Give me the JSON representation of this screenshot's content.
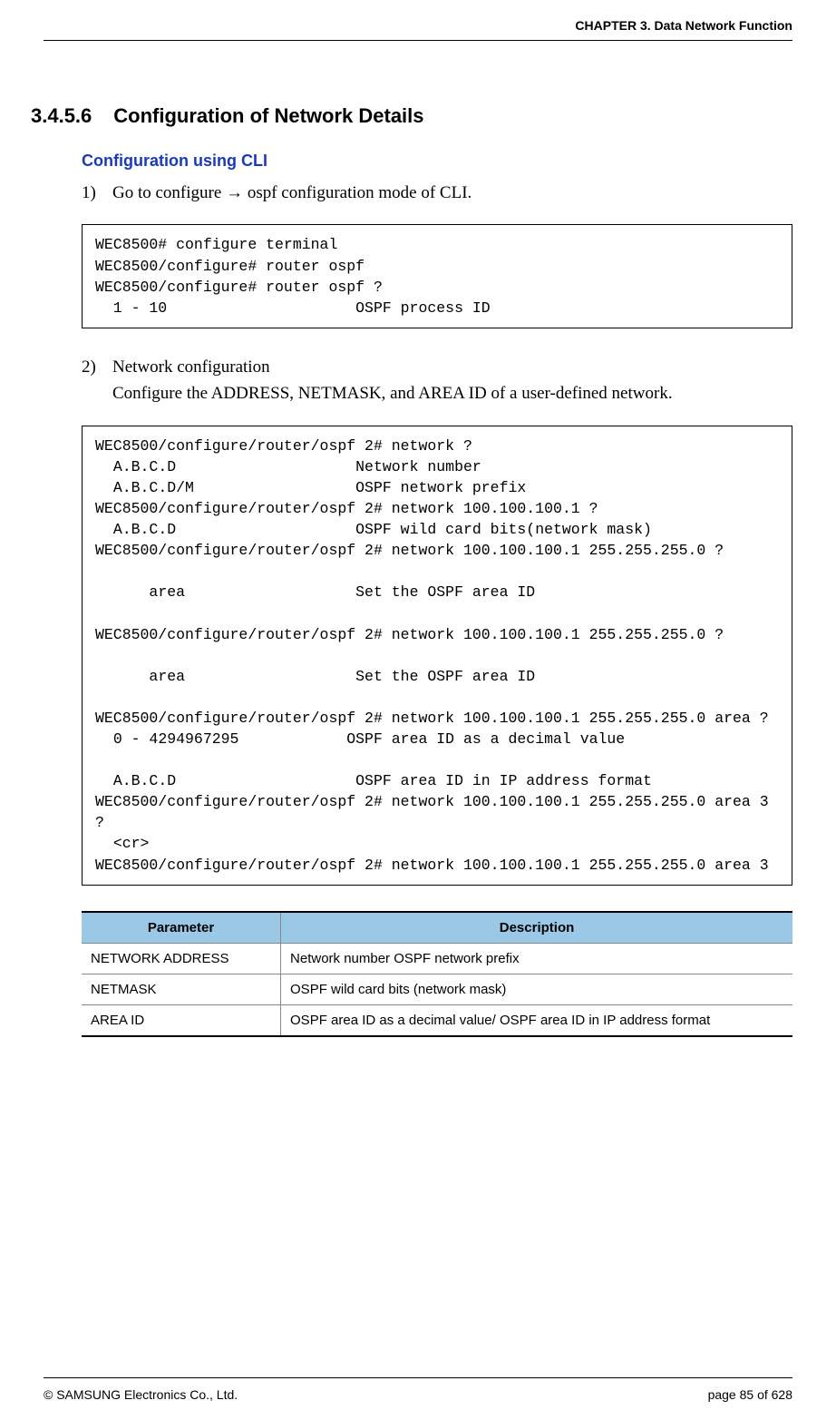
{
  "header": {
    "chapter": "CHAPTER 3. Data Network Function"
  },
  "section": {
    "number": "3.4.5.6",
    "title": "Configuration of Network Details"
  },
  "subheading": "Configuration using CLI",
  "step1": {
    "num": "1)",
    "text_before": "Go to configure ",
    "arrow": "→",
    "text_after": " ospf configuration mode of CLI."
  },
  "code1": "WEC8500# configure terminal\nWEC8500/configure# router ospf\nWEC8500/configure# router ospf ?\n  1 - 10                     OSPF process ID",
  "step2": {
    "num": "2)",
    "line1": "Network configuration",
    "line2": "Configure the ADDRESS, NETMASK, and AREA ID of a user-defined network."
  },
  "code2": "WEC8500/configure/router/ospf 2# network ?\n  A.B.C.D                    Network number\n  A.B.C.D/M                  OSPF network prefix\nWEC8500/configure/router/ospf 2# network 100.100.100.1 ?\n  A.B.C.D                    OSPF wild card bits(network mask)\nWEC8500/configure/router/ospf 2# network 100.100.100.1 255.255.255.0 ?\n\n      area                   Set the OSPF area ID\n\nWEC8500/configure/router/ospf 2# network 100.100.100.1 255.255.255.0 ?\n\n      area                   Set the OSPF area ID\n\nWEC8500/configure/router/ospf 2# network 100.100.100.1 255.255.255.0 area ?\n  0 - 4294967295            OSPF area ID as a decimal value\n\n  A.B.C.D                    OSPF area ID in IP address format\nWEC8500/configure/router/ospf 2# network 100.100.100.1 255.255.255.0 area 3  ?\n  <cr>\nWEC8500/configure/router/ospf 2# network 100.100.100.1 255.255.255.0 area 3",
  "table": {
    "headers": {
      "param": "Parameter",
      "desc": "Description"
    },
    "rows": [
      {
        "param": "NETWORK ADDRESS",
        "desc": "Network number OSPF network prefix"
      },
      {
        "param": "NETMASK",
        "desc": "OSPF wild card bits (network mask)"
      },
      {
        "param": "AREA ID",
        "desc": "OSPF area ID as a decimal value/ OSPF area ID in IP address format"
      }
    ]
  },
  "footer": {
    "copyright": "© SAMSUNG Electronics Co., Ltd.",
    "page": "page 85 of 628"
  }
}
